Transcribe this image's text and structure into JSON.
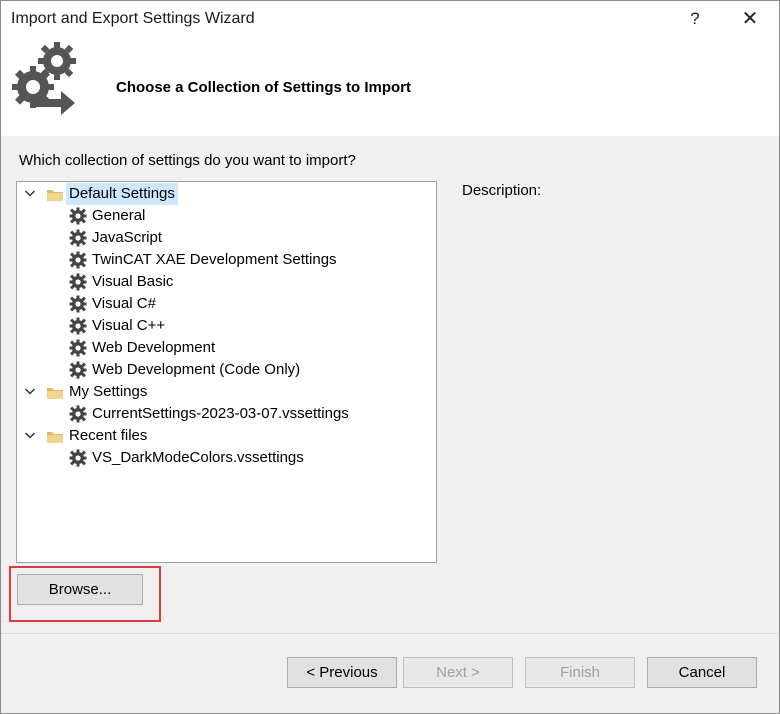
{
  "window": {
    "title": "Import and Export Settings Wizard",
    "help_label": "?",
    "close_label": "✕"
  },
  "header": {
    "title": "Choose a Collection of Settings to Import",
    "icon": "gears-arrow-icon"
  },
  "prompt": {
    "text": "Which collection of settings do you want to import?"
  },
  "tree": {
    "groups": [
      {
        "label": "Default Settings",
        "selected": true,
        "items": [
          "General",
          "JavaScript",
          "TwinCAT XAE Development Settings",
          "Visual Basic",
          "Visual C#",
          "Visual C++",
          "Web Development",
          "Web Development (Code Only)"
        ]
      },
      {
        "label": "My Settings",
        "selected": false,
        "items": [
          "CurrentSettings-2023-03-07.vssettings"
        ]
      },
      {
        "label": "Recent files",
        "selected": false,
        "items": [
          "VS_DarkModeColors.vssettings"
        ]
      }
    ]
  },
  "description": {
    "label": "Description:"
  },
  "buttons": {
    "browse": "Browse...",
    "previous": "< Previous",
    "next": "Next >",
    "finish": "Finish",
    "cancel": "Cancel"
  },
  "colors": {
    "selection": "#cce8ff",
    "highlight_box": "#e0393e",
    "folder": "#dcb867"
  }
}
